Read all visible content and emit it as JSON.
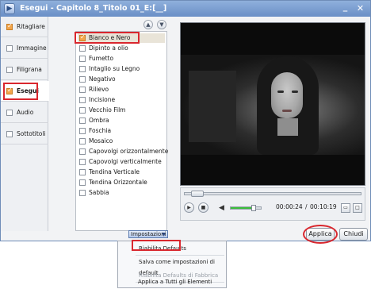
{
  "window": {
    "title": "Esegui - Capitolo 8_Titolo 01_E:[__]"
  },
  "titlebar": {
    "minimize_icon": "minimize-icon",
    "close_icon": "close-icon"
  },
  "sidebar": {
    "items": [
      {
        "label": "Ritagliare",
        "checked": true
      },
      {
        "label": "Immagine",
        "checked": false
      },
      {
        "label": "Filigrana",
        "checked": false
      },
      {
        "label": "Esegui",
        "checked": true,
        "active": true
      },
      {
        "label": "Audio",
        "checked": false
      },
      {
        "label": "Sottotitoli",
        "checked": false
      }
    ]
  },
  "filters": [
    {
      "label": "Bianco e Nero",
      "checked": true,
      "selected": true
    },
    {
      "label": "Dipinto a olio",
      "checked": false
    },
    {
      "label": "Fumetto",
      "checked": false
    },
    {
      "label": "Intaglio su Legno",
      "checked": false
    },
    {
      "label": "Negativo",
      "checked": false
    },
    {
      "label": "Rilievo",
      "checked": false
    },
    {
      "label": "Incisione",
      "checked": false
    },
    {
      "label": "Vecchio Film",
      "checked": false
    },
    {
      "label": "Ombra",
      "checked": false
    },
    {
      "label": "Foschia",
      "checked": false
    },
    {
      "label": "Mosaico",
      "checked": false
    },
    {
      "label": "Capovolgi orizzontalmente",
      "checked": false
    },
    {
      "label": "Capovolgi verticalmente",
      "checked": false
    },
    {
      "label": "Tendina Verticale",
      "checked": false
    },
    {
      "label": "Tendina Orizzontale",
      "checked": false
    },
    {
      "label": "Sabbia",
      "checked": false
    }
  ],
  "player": {
    "current_time": "00:00:24",
    "separator": "/",
    "total_time": "00:10:19",
    "progress_fraction": 0.04,
    "volume_fraction": 0.75
  },
  "buttons": {
    "apply": "Applica",
    "close": "Chiudi"
  },
  "settings_dropdown": {
    "label": "Impostazioni"
  },
  "settings_menu": {
    "items": [
      {
        "label": "Riabilita Defaults",
        "disabled": false,
        "highlighted": true
      },
      {
        "label": "Salva come impostazioni di default",
        "disabled": false
      },
      {
        "label": "Riabilita Defaults di Fabbrica",
        "disabled": true
      },
      {
        "label": "Applica a Tutti gli Elementi",
        "disabled": false
      }
    ]
  },
  "colors": {
    "highlight_red": "#d9272e",
    "checkbox_orange": "#f3a54a",
    "volume_green": "#3bbd3b"
  }
}
